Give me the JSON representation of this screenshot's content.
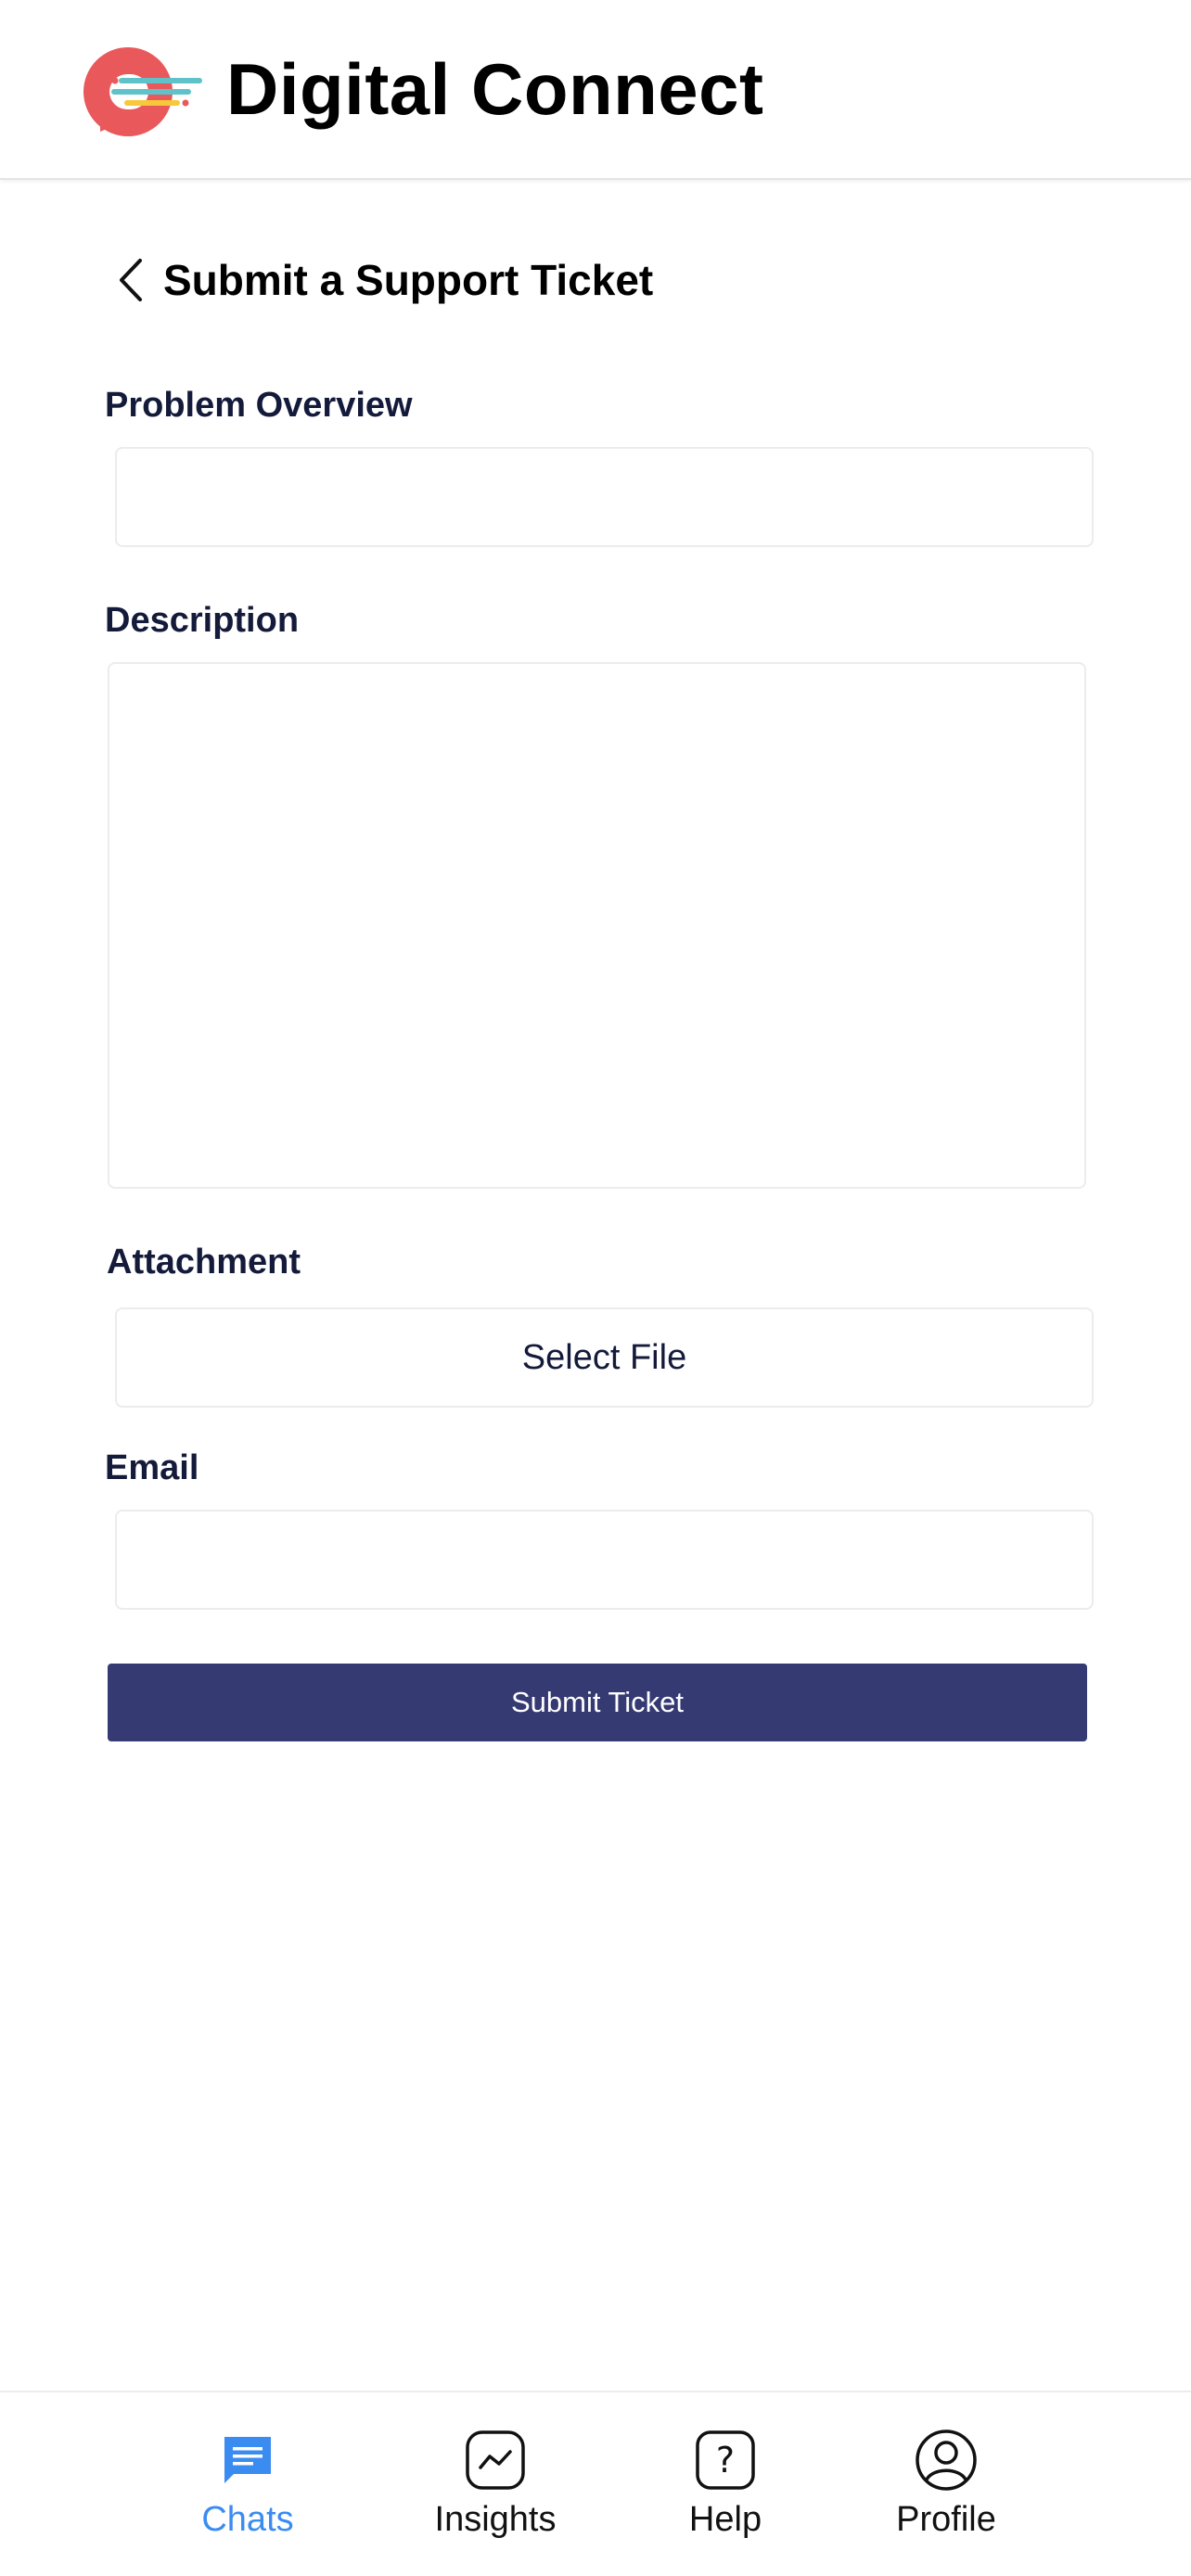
{
  "header": {
    "app_title": "Digital Connect",
    "logo_colors": {
      "circle": "#e9585a",
      "line1": "#5fc2c9",
      "line2": "#f7c93a",
      "dot": "#e9585a"
    }
  },
  "page": {
    "title": "Submit a Support Ticket",
    "back_icon": "chevron-left-icon"
  },
  "form": {
    "problem_overview": {
      "label": "Problem Overview",
      "value": "",
      "placeholder": ""
    },
    "description": {
      "label": "Description",
      "value": "",
      "placeholder": ""
    },
    "attachment": {
      "label": "Attachment",
      "button_label": "Select File"
    },
    "email": {
      "label": "Email",
      "value": "",
      "placeholder": ""
    },
    "submit_label": "Submit Ticket"
  },
  "colors": {
    "accent": "#363a73",
    "active_tab": "#3b8cf0",
    "label_text": "#141a3a"
  },
  "tabbar": {
    "active": "chats",
    "items": [
      {
        "id": "chats",
        "label": "Chats",
        "icon": "chat-icon"
      },
      {
        "id": "insights",
        "label": "Insights",
        "icon": "chart-icon"
      },
      {
        "id": "help",
        "label": "Help",
        "icon": "help-icon"
      },
      {
        "id": "profile",
        "label": "Profile",
        "icon": "profile-icon"
      }
    ]
  }
}
